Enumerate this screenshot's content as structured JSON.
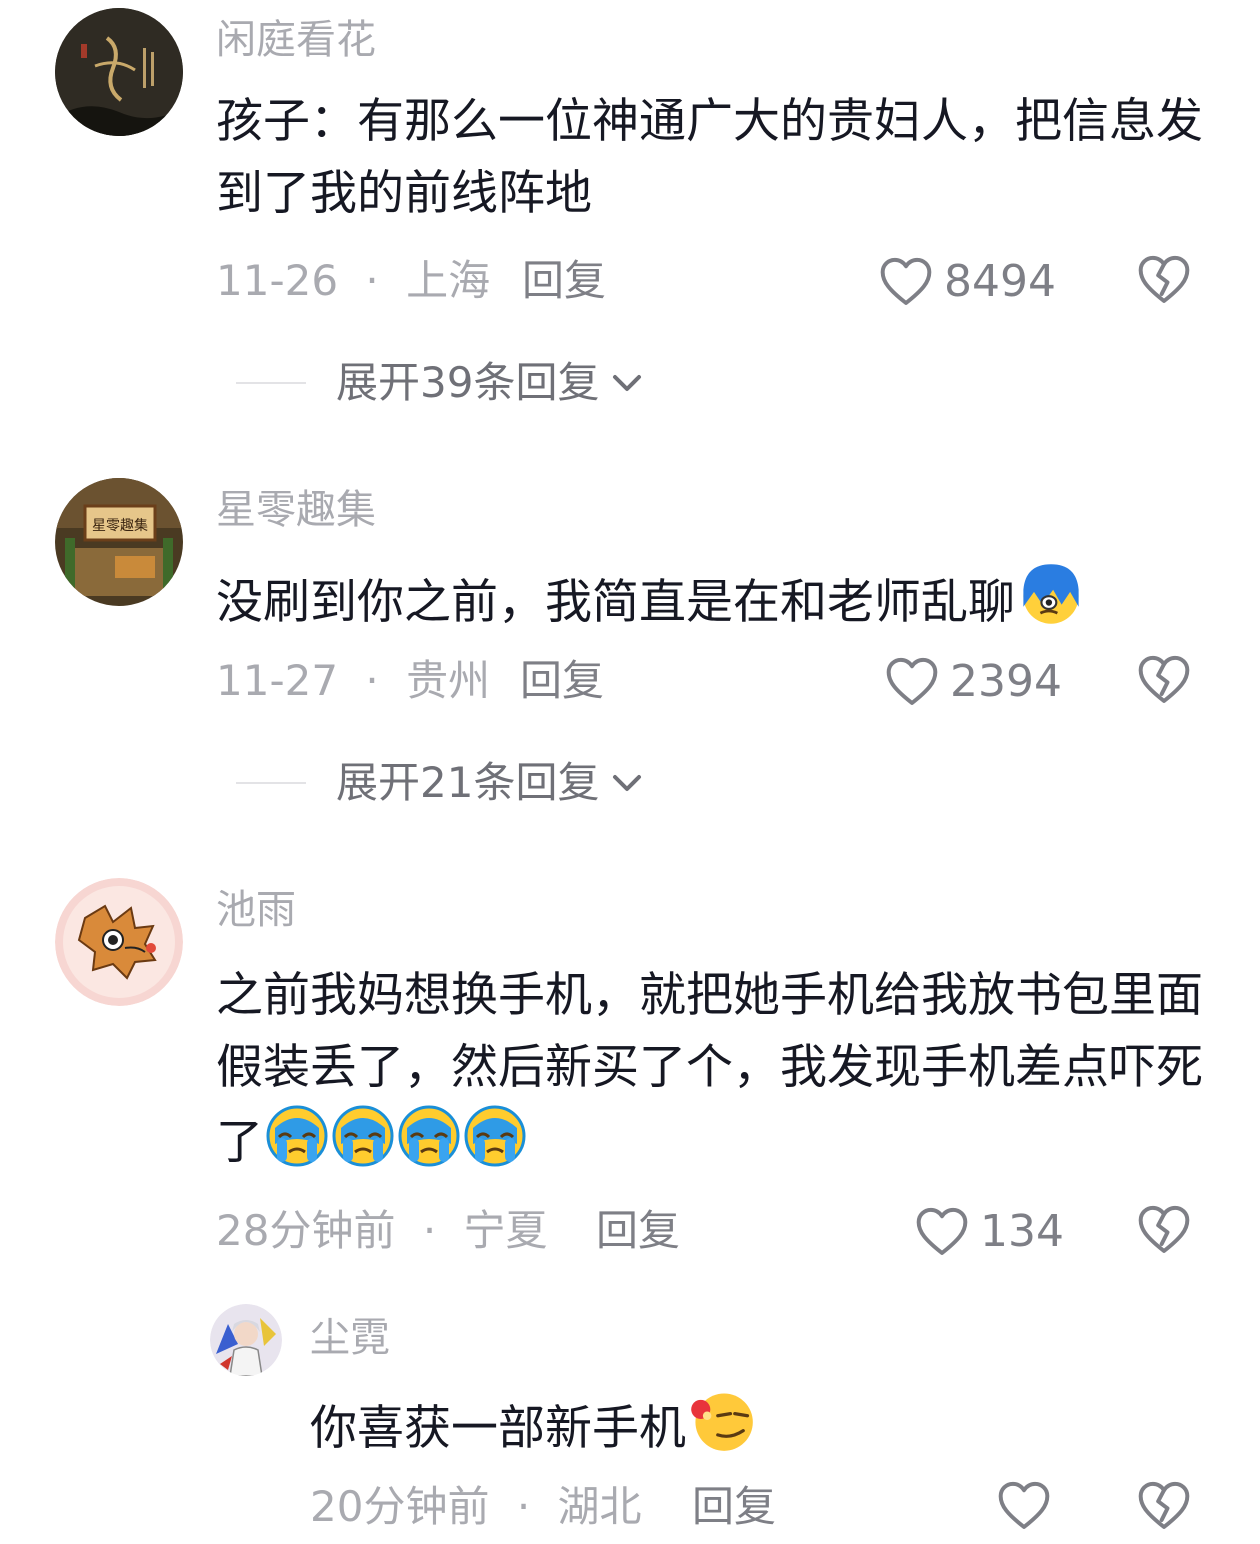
{
  "comments": [
    {
      "username": "闲庭看花",
      "text": "孩子：有那么一位神通广大的贵妇人，把信息发到了我的前线阵地",
      "date": "11-26",
      "location": "上海",
      "reply_label": "回复",
      "likes": "8494",
      "expand_label": "展开39条回复"
    },
    {
      "username": "星零趣集",
      "avatar_text": "星零趣集",
      "text": "没刷到你之前，我简直是在和老师乱聊",
      "date": "11-27",
      "location": "贵州",
      "reply_label": "回复",
      "likes": "2394",
      "expand_label": "展开21条回复"
    },
    {
      "username": "池雨",
      "text": "之前我妈想换手机，就把她手机给我放书包里面假装丢了，然后新买了个，我发现手机差点吓死了",
      "date": "28分钟前",
      "location": "宁夏",
      "reply_label": "回复",
      "likes": "134"
    },
    {
      "username": "尘霓",
      "text": "你喜获一部新手机",
      "date": "20分钟前",
      "location": "湖北",
      "reply_label": "回复",
      "likes": ""
    }
  ],
  "separator": "·",
  "icons": {
    "like": "heart-outline-icon",
    "dislike": "broken-heart-icon",
    "expand": "chevron-down-icon"
  },
  "colors": {
    "text": "#161823",
    "muted": "#a9aab0",
    "secondary": "#7e7f86"
  }
}
